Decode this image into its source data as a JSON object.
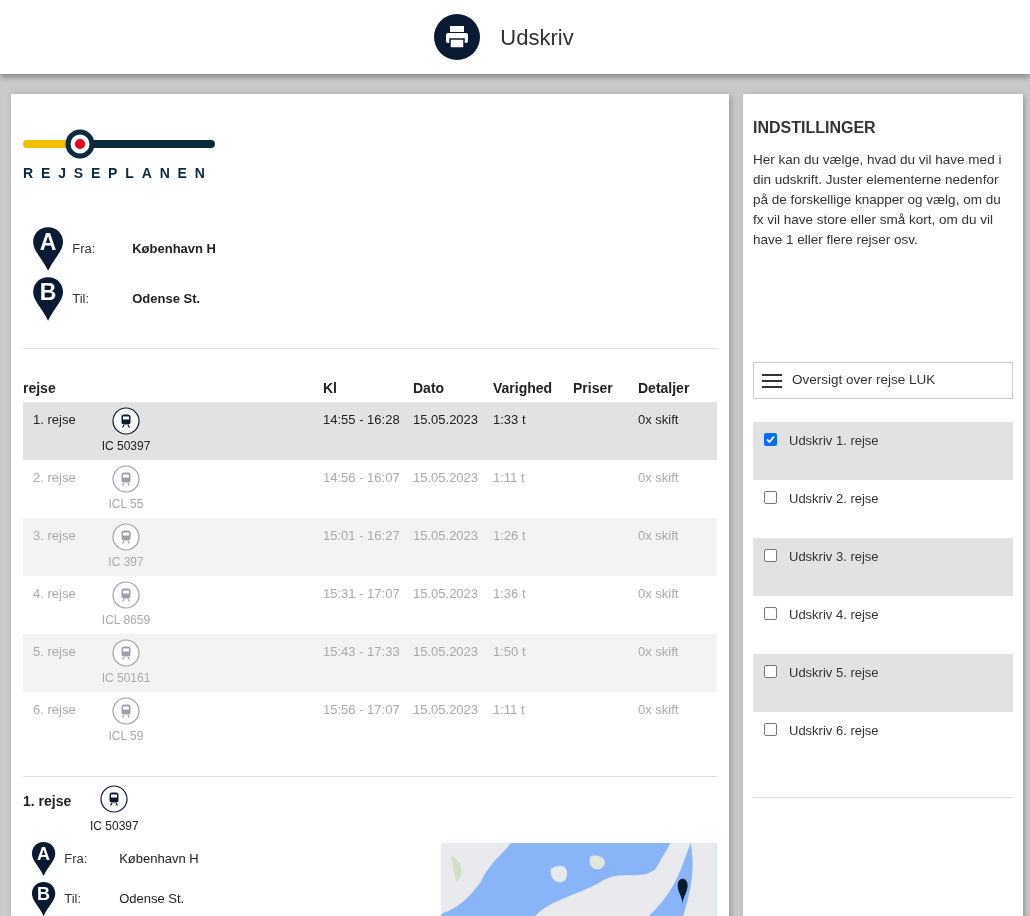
{
  "header": {
    "title": "Udskriv"
  },
  "logo": {
    "text": "REJSEPLANEN"
  },
  "route": [
    {
      "marker": "A",
      "label": "Fra:",
      "value": "København H"
    },
    {
      "marker": "B",
      "label": "Til:",
      "value": "Odense St."
    }
  ],
  "table": {
    "columns": [
      "rejse",
      "Kl",
      "Dato",
      "Varighed",
      "Priser",
      "Detaljer"
    ],
    "rows": [
      {
        "name": "1. rejse",
        "train": "IC 50397",
        "time": "14:55 - 16:28",
        "date": "15.05.2023",
        "duration": "1:33 t",
        "details": "0x skift",
        "selected": true
      },
      {
        "name": "2. rejse",
        "train": "ICL 55",
        "time": "14:56 - 16:07",
        "date": "15.05.2023",
        "duration": "1:11 t",
        "details": "0x skift",
        "selected": false
      },
      {
        "name": "3. rejse",
        "train": "IC 397",
        "time": "15:01 - 16:27",
        "date": "15.05.2023",
        "duration": "1:26 t",
        "details": "0x skift",
        "selected": false
      },
      {
        "name": "4. rejse",
        "train": "ICL 8659",
        "time": "15:31 - 17:07",
        "date": "15.05.2023",
        "duration": "1:36 t",
        "details": "0x skift",
        "selected": false
      },
      {
        "name": "5. rejse",
        "train": "IC 50161",
        "time": "15:43 - 17:33",
        "date": "15.05.2023",
        "duration": "1:50 t",
        "details": "0x skift",
        "selected": false
      },
      {
        "name": "6. rejse",
        "train": "ICL 59",
        "time": "15:56 - 17:07",
        "date": "15.05.2023",
        "duration": "1:11 t",
        "details": "0x skift",
        "selected": false
      }
    ]
  },
  "detail": {
    "title": "1. rejse",
    "train": "IC 50397",
    "route": [
      {
        "marker": "A",
        "label": "Fra:",
        "value": "København H"
      },
      {
        "marker": "B",
        "label": "Til:",
        "value": "Odense St."
      }
    ]
  },
  "settings": {
    "title": "INDSTILLINGER",
    "text": "Her kan du vælge, hvad du vil have med i din udskrift. Juster elementerne nedenfor på de forskellige knapper og vælg, om du fx vil have store eller små kort, om du vil have 1 eller flere rejser osv.",
    "menu_button": "Oversigt over rejse LUK",
    "options": [
      {
        "label": "Udskriv 1. rejse",
        "checked": true
      },
      {
        "label": "Udskriv 2. rejse",
        "checked": false
      },
      {
        "label": "Udskriv 3. rejse",
        "checked": false
      },
      {
        "label": "Udskriv 4. rejse",
        "checked": false
      },
      {
        "label": "Udskriv 5. rejse",
        "checked": false
      },
      {
        "label": "Udskriv 6. rejse",
        "checked": false
      }
    ]
  }
}
